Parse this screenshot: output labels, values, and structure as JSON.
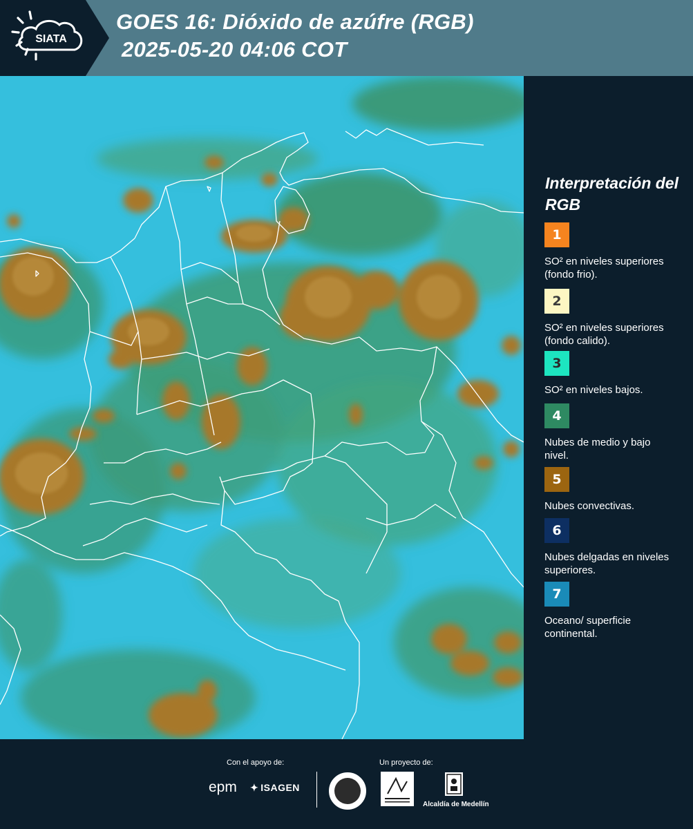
{
  "header": {
    "logo_text": "SIATA",
    "title_line1": "GOES 16: Dióxido de azúfre (RGB)",
    "title_line2": "2025-05-20 04:06 COT"
  },
  "legend": {
    "title": "Interpretación del RGB",
    "items": [
      {
        "number": "1",
        "color": "#f5841f",
        "text_color": "#ffffff",
        "label": "SO² en niveles superiores (fondo frio)."
      },
      {
        "number": "2",
        "color": "#fdf6c3",
        "text_color": "#3b3b3b",
        "label": "SO² en niveles superiores (fondo calido)."
      },
      {
        "number": "3",
        "color": "#1de5c0",
        "text_color": "#2b2b2b",
        "label": "SO² en niveles bajos."
      },
      {
        "number": "4",
        "color": "#2e8a62",
        "text_color": "#ffffff",
        "label": "Nubes de medio y bajo nivel."
      },
      {
        "number": "5",
        "color": "#9c6510",
        "text_color": "#ffffff",
        "label": "Nubes convectivas."
      },
      {
        "number": "6",
        "color": "#0d2f62",
        "text_color": "#ffffff",
        "label": "Nubes delgadas en niveles superiores."
      },
      {
        "number": "7",
        "color": "#1a8bb8",
        "text_color": "#ffffff",
        "label": "Oceano/ superficie continental."
      }
    ]
  },
  "footer": {
    "support_label": "Con el apoyo de:",
    "project_label": "Un proyecto de:",
    "epm_logo": "epm",
    "isagen_logo": "ISAGEN",
    "amva_logo": "Área Metropolitana Valle de Aburrá",
    "alcaldia_logo": "Alcaldía de Medellín"
  },
  "colors": {
    "header_bg": "#507b8a",
    "panel_bg": "#0c1e2c",
    "ocean_land": "#35bfdd",
    "mid_low_cloud": "#3a9a76",
    "convective_cloud": "#a4731f"
  }
}
